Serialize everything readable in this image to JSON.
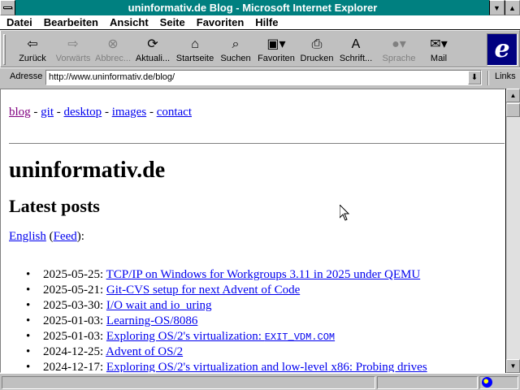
{
  "window": {
    "title": "uninformativ.de Blog - Microsoft Internet Explorer"
  },
  "menu": [
    "Datei",
    "Bearbeiten",
    "Ansicht",
    "Seite",
    "Favoriten",
    "Hilfe"
  ],
  "toolbar": {
    "buttons": [
      {
        "label": "Zurück",
        "icon": "back-arrow-icon",
        "enabled": true
      },
      {
        "label": "Vorwärts",
        "icon": "forward-arrow-icon",
        "enabled": false
      },
      {
        "label": "Abbrec...",
        "icon": "stop-icon",
        "enabled": false
      },
      {
        "label": "Aktuali...",
        "icon": "refresh-icon",
        "enabled": true
      },
      {
        "label": "Startseite",
        "icon": "home-icon",
        "enabled": true
      },
      {
        "label": "Suchen",
        "icon": "search-icon",
        "enabled": true
      },
      {
        "label": "Favoriten",
        "icon": "favorites-icon",
        "enabled": true
      },
      {
        "label": "Drucken",
        "icon": "print-icon",
        "enabled": true
      },
      {
        "label": "Schrift...",
        "icon": "font-icon",
        "enabled": true
      },
      {
        "label": "Sprache",
        "icon": "language-icon",
        "enabled": false
      },
      {
        "label": "Mail",
        "icon": "mail-icon",
        "enabled": true
      }
    ],
    "logo": "e"
  },
  "address": {
    "label": "Adresse",
    "value": "http://www.uninformativ.de/blog/",
    "links_label": "Links"
  },
  "page": {
    "nav": [
      {
        "label": "blog",
        "visited": true
      },
      {
        "label": "git"
      },
      {
        "label": "desktop"
      },
      {
        "label": "images"
      },
      {
        "label": "contact"
      }
    ],
    "nav_separator": "-",
    "site_title": "uninformativ.de",
    "section_title": "Latest posts",
    "lang_link": "English",
    "lang_feed": "Feed",
    "lang_open": "(",
    "lang_close": "):",
    "posts": [
      {
        "date": "2025-05-25:",
        "title": "TCP/IP on Windows for Workgroups 3.11 in 2025 under QEMU"
      },
      {
        "date": "2025-05-21:",
        "title": "Git-CVS setup for next Advent of Code"
      },
      {
        "date": "2025-03-30:",
        "title": "I/O wait and io_uring"
      },
      {
        "date": "2025-01-03:",
        "title": "Learning-OS/8086"
      },
      {
        "date": "2025-01-03:",
        "title": "Exploring OS/2's virtualization: ",
        "code": "EXIT_VDM.COM"
      },
      {
        "date": "2024-12-25:",
        "title": "Advent of OS/2"
      },
      {
        "date": "2024-12-17:",
        "title": "Exploring OS/2's virtualization and low-level x86: Probing drives"
      }
    ],
    "bullet": "•"
  },
  "colors": {
    "titlebar": "#008080",
    "link": "#0000ee",
    "visited": "#800080",
    "face": "#c0c0c0"
  }
}
